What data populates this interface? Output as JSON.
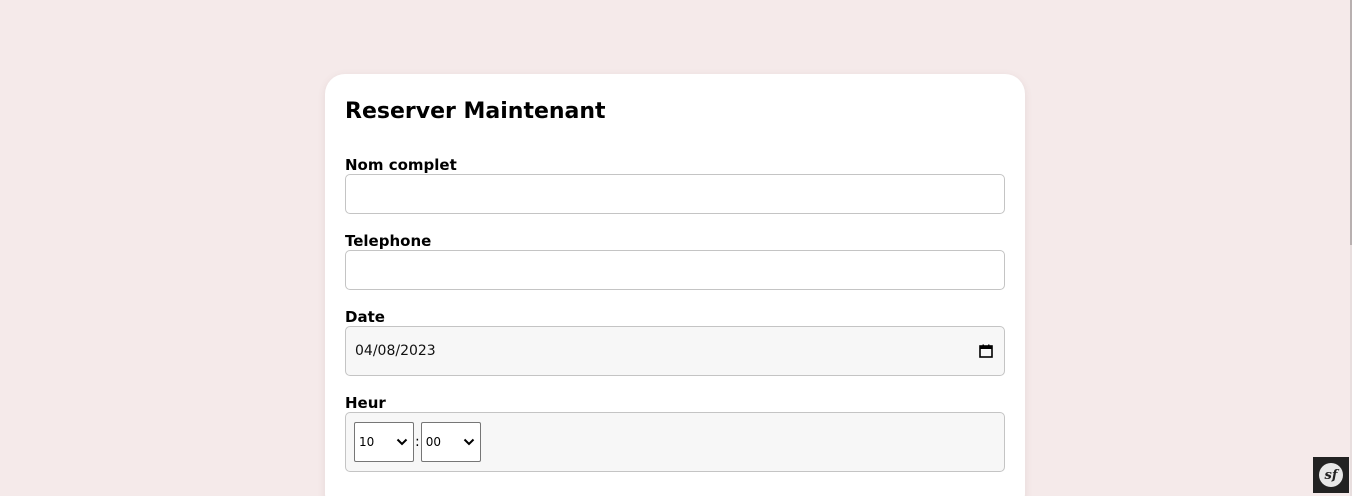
{
  "form": {
    "title": "Reserver Maintenant",
    "fields": {
      "nom": {
        "label": "Nom complet",
        "value": "",
        "placeholder": ""
      },
      "telephone": {
        "label": "Telephone",
        "value": "",
        "placeholder": ""
      },
      "date": {
        "label": "Date",
        "value": "04/08/2023"
      },
      "heur": {
        "label": "Heur",
        "hour": "10",
        "separator": ":",
        "minute": "00"
      }
    }
  },
  "toolbar": {
    "logo_text": "sf"
  },
  "colors": {
    "background": "#f5eaea",
    "card": "#ffffff",
    "input_border": "#c4c4c4",
    "toolbar": "#222222"
  },
  "icons": [
    "calendar-icon",
    "chevron-down-icon",
    "symfony-logo-icon"
  ]
}
